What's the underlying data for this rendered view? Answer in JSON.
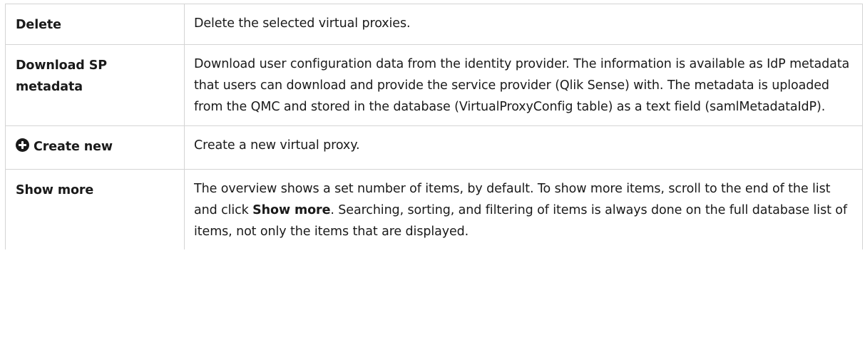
{
  "rows": [
    {
      "term": "Delete",
      "description": "Delete the selected virtual proxies."
    },
    {
      "term_line1": "Download SP",
      "term_line2": "metadata",
      "description": "Download user configuration data from the identity provider. The information is available as IdP metadata that users can download and provide the service provider (Qlik Sense) with. The metadata is uploaded from the QMC and stored in the database (VirtualProxyConfig table) as a text field (samlMetadataIdP)."
    },
    {
      "term": "Create new",
      "icon": "plus-circle-icon",
      "description": "Create a new virtual proxy."
    },
    {
      "term": "Show more",
      "description_part1": "The overview shows a set number of items, by default. To show more items, scroll to the end of the list and click ",
      "description_bold": "Show more",
      "description_part2": ". Searching, sorting, and filtering of items is always done on the full database list of items, not only the items that are displayed."
    }
  ]
}
